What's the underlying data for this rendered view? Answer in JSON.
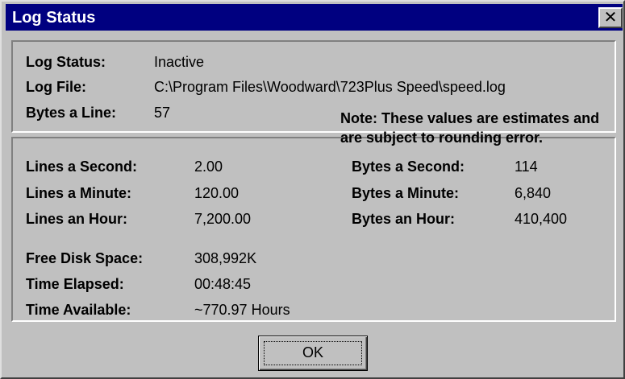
{
  "window": {
    "title": "Log Status",
    "close_label": "✕"
  },
  "log_info": {
    "status_label": "Log Status:",
    "status_value": "Inactive",
    "file_label": "Log File:",
    "file_value": "C:\\Program Files\\Woodward\\723Plus Speed\\speed.log",
    "bytes_line_label": "Bytes a Line:",
    "bytes_line_value": "57"
  },
  "rates": {
    "lines_second_label": "Lines a Second:",
    "lines_second_value": "2.00",
    "lines_minute_label": "Lines a Minute:",
    "lines_minute_value": "120.00",
    "lines_hour_label": "Lines an Hour:",
    "lines_hour_value": "7,200.00",
    "bytes_second_label": "Bytes a Second:",
    "bytes_second_value": "114",
    "bytes_minute_label": "Bytes a Minute:",
    "bytes_minute_value": "6,840",
    "bytes_hour_label": "Bytes an Hour:",
    "bytes_hour_value": "410,400"
  },
  "disk": {
    "free_space_label": "Free Disk Space:",
    "free_space_value": "308,992K",
    "elapsed_label": "Time Elapsed:",
    "elapsed_value": "00:48:45",
    "available_label": "Time Available:",
    "available_value": "~770.97 Hours"
  },
  "note": "Note: These values are estimates and are subject to rounding error.",
  "buttons": {
    "ok_label": "OK"
  },
  "colors": {
    "titlebar": "#000080",
    "face": "#c0c0c0"
  }
}
